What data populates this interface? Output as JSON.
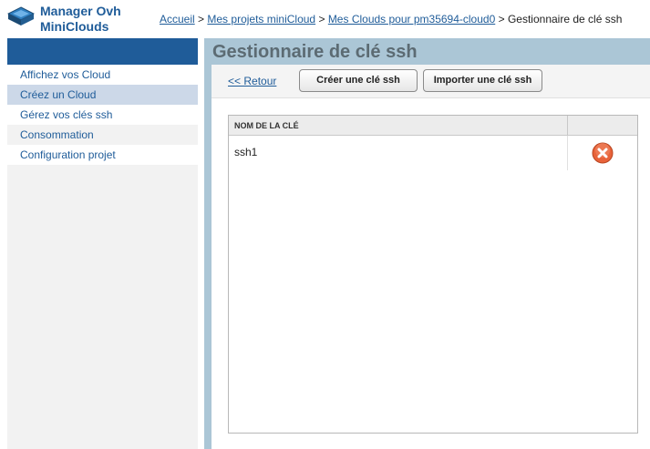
{
  "header": {
    "logo_line1": "Manager Ovh",
    "logo_line2": "MiniClouds",
    "logo_icon": "cloud-diamond-icon"
  },
  "breadcrumb": {
    "items": [
      "Accueil",
      "Mes projets miniCloud",
      "Mes Clouds pour pm35694-cloud0"
    ],
    "separator": ">",
    "current": "Gestionnaire de clé ssh"
  },
  "sidebar": {
    "items": [
      {
        "label": "Affichez vos Cloud",
        "state": "normal"
      },
      {
        "label": "Créez un Cloud",
        "state": "active"
      },
      {
        "label": "Gérez vos clés ssh",
        "state": "normal"
      },
      {
        "label": "Consommation",
        "state": "normal"
      },
      {
        "label": "Configuration projet",
        "state": "normal"
      }
    ]
  },
  "main": {
    "title": "Gestionnaire de clé ssh",
    "back_label": "<< Retour",
    "create_button": "Créer une clé ssh",
    "import_button": "Importer une clé ssh",
    "table": {
      "columns": [
        "NOM DE LA CLÉ",
        ""
      ],
      "rows": [
        {
          "name": "ssh1",
          "action_icon": "delete-icon"
        }
      ]
    }
  },
  "colors": {
    "brand_blue": "#1f5c99",
    "panel_blue": "#abc6d6",
    "delete_orange": "#e8633a"
  }
}
